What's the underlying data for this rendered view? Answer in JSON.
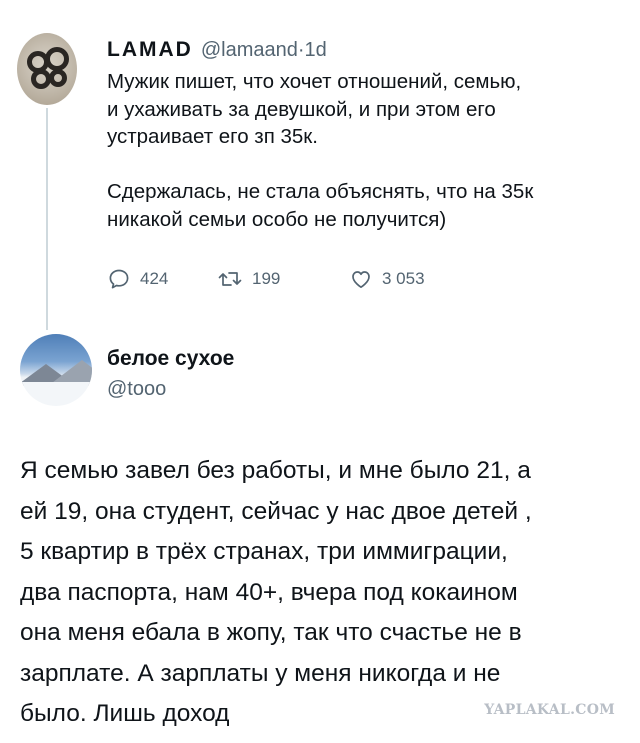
{
  "tweet1": {
    "display_name": "LAMAD",
    "handle": "@lamaand",
    "separator": "·",
    "time": "1d",
    "text_lines": [
      "Мужик пишет, что хочет отношений, семью,",
      "и ухаживать за девушкой, и при этом его",
      "устраивает его зп 35к.",
      "",
      "Сдержалась, не стала объяснять, что на 35к",
      "никакой семьи особо не получится)"
    ],
    "actions": {
      "replies": "424",
      "retweets": "199",
      "likes": "3 053"
    },
    "icons": {
      "reply": "reply-bubble-icon",
      "retweet": "retweet-icon",
      "like": "heart-icon"
    }
  },
  "tweet2": {
    "display_name": "белое сухое",
    "handle": "@tooo",
    "text_lines": [
      "Я семью завел без работы, и мне было 21, а",
      "ей 19, она студент, сейчас у нас двое детей ,",
      "5 квартир в трёх странах, три иммиграции,",
      "два паспорта, нам 40+, вчера под кокаином",
      "она меня ебала в жопу, так что счастье не в",
      "зарплате. А зарплаты у меня никогда и не",
      "было. Лишь доход"
    ]
  },
  "watermark": "YAPLAKAL.COM",
  "colors": {
    "text": "#0f1419",
    "secondary": "#536471",
    "thread_line": "#cfd9de",
    "watermark": "#b8bec6"
  }
}
